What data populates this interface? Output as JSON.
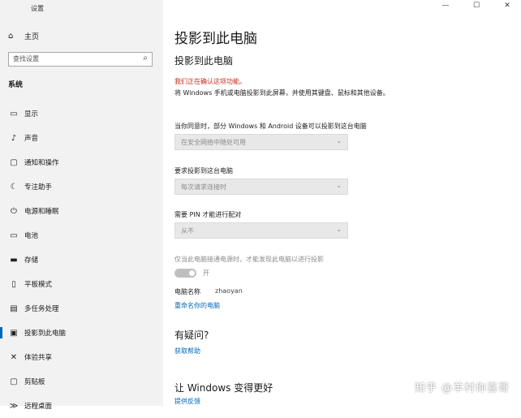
{
  "window": {
    "title": "设置",
    "controls": [
      "—",
      "☐",
      "✕"
    ]
  },
  "sidebar": {
    "home_label": "主页",
    "search_placeholder": "查找设置",
    "section_title": "系统",
    "items": [
      {
        "label": "显示",
        "icon": "display-icon"
      },
      {
        "label": "声音",
        "icon": "speaker-icon"
      },
      {
        "label": "通知和操作",
        "icon": "notification-icon"
      },
      {
        "label": "专注助手",
        "icon": "moon-icon"
      },
      {
        "label": "电源和睡眠",
        "icon": "power-icon"
      },
      {
        "label": "电池",
        "icon": "battery-icon"
      },
      {
        "label": "存储",
        "icon": "storage-icon"
      },
      {
        "label": "平板模式",
        "icon": "tablet-icon"
      },
      {
        "label": "多任务处理",
        "icon": "multitask-icon"
      },
      {
        "label": "投影到此电脑",
        "icon": "project-icon",
        "active": true
      },
      {
        "label": "体验共享",
        "icon": "share-icon"
      },
      {
        "label": "剪贴板",
        "icon": "clipboard-icon"
      },
      {
        "label": "远程桌面",
        "icon": "remote-desktop-icon"
      }
    ]
  },
  "main": {
    "page_title": "投影到此电脑",
    "sub_title": "投影到此电脑",
    "warning": "我们正在确认这项功能。",
    "description": "将 Windows 手机或电脑投影到此屏幕，并使用其键盘、鼠标和其他设备。",
    "setting1_label": "当你同意时，部分 Windows 和 Android 设备可以投影到这台电脑",
    "setting1_value": "在安全网络中随处可用",
    "setting2_label": "要求投影到这台电脑",
    "setting2_value": "每次请求连接时",
    "setting3_label": "需要 PIN 才能进行配对",
    "setting3_value": "从不",
    "power_note": "仅当此电脑接通电源时，才能发现此电脑以进行投影",
    "toggle_label": "开",
    "pc_name_label": "电脑名称",
    "pc_name_value": "zhaoyan",
    "rename_link": "重命名你的电脑",
    "question_heading": "有疑问?",
    "help_link": "获取帮助",
    "improve_heading": "让 Windows 变得更好",
    "feedback_link": "提供反馈"
  },
  "watermark": "知乎 @羊村你喜哥",
  "colors": {
    "accent": "#0067b8",
    "warning": "#c42b1c",
    "sidebar_bg": "#f2f2f2"
  }
}
